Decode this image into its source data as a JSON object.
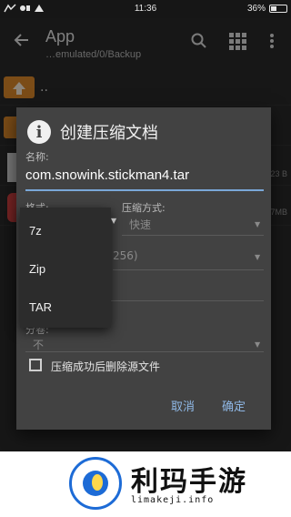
{
  "status_bar": {
    "time": "11:36",
    "battery": "36%"
  },
  "app_bar": {
    "title": "App",
    "path": "…emulated/0/Backup",
    "icons": [
      "back-arrow-icon",
      "search-icon",
      "grid-view-icon",
      "more-vert-icon"
    ]
  },
  "background_list": {
    "parent_label": "..",
    "notes": [
      "23 B",
      "7MB"
    ]
  },
  "dialog": {
    "title": "创建压缩文档",
    "name_label": "名称:",
    "name_value": "com.snowink.stickman4.tar",
    "format_label": "格式:",
    "compression_label": "压缩方式:",
    "compression_value": "快速",
    "partial_value": "256)",
    "partial_label": "分卷:",
    "split_value": "不",
    "delete_source_label": "压缩成功后删除源文件",
    "cancel_label": "取消",
    "ok_label": "确定"
  },
  "format_dropdown": {
    "options": [
      "7z",
      "Zip",
      "TAR"
    ]
  },
  "banner": {
    "brand": "利玛手游",
    "url": "limakeji.info"
  },
  "colors": {
    "accent": "#7aa7d8",
    "folder": "#e08a2a",
    "dialog_bg": "#424242"
  }
}
